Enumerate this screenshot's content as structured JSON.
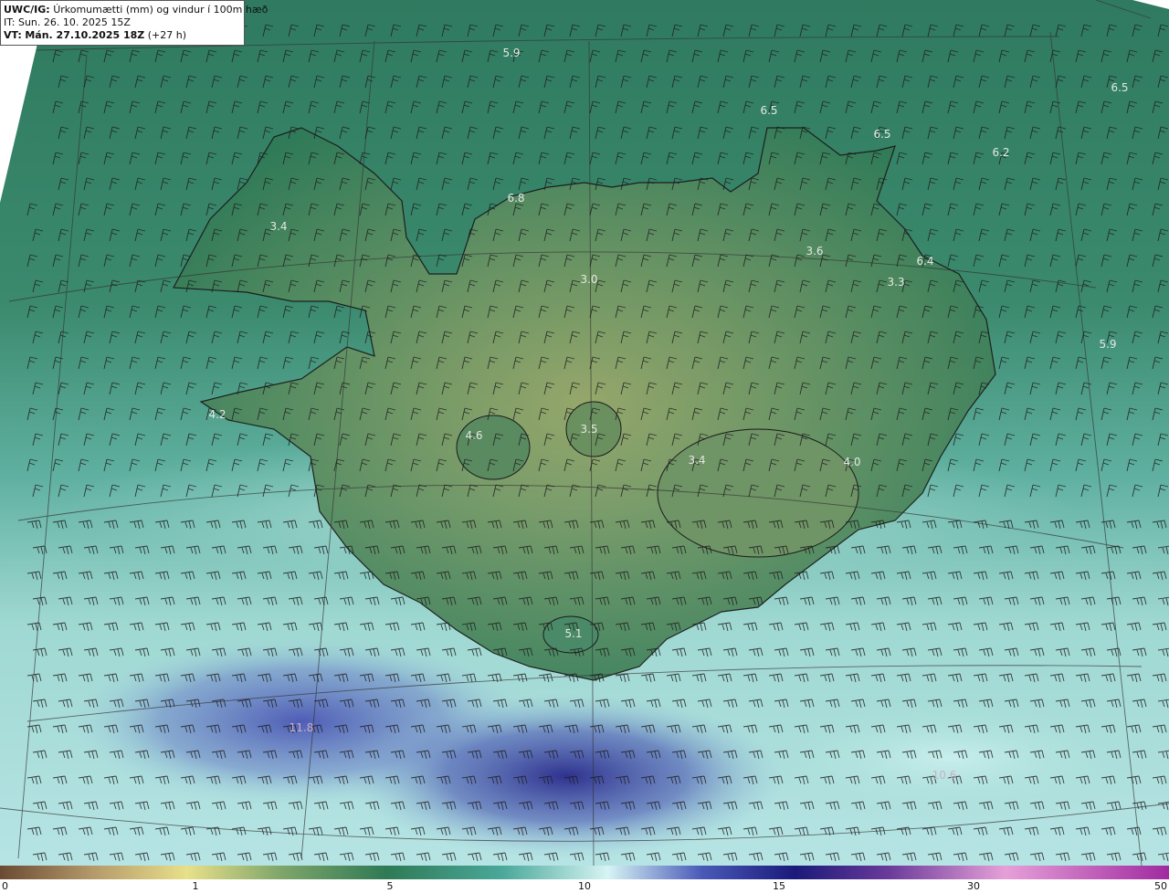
{
  "header": {
    "product_code": "UWC/IG:",
    "product_desc": "Úrkomumætti (mm) og vindur í 100m hæð",
    "init_prefix": "IT:",
    "init_time": "Sun. 26. 10. 2025 15Z",
    "valid_prefix": "VT:",
    "valid_time": "Mán. 27.10.2025 18Z",
    "lead_time": "(+27 h)"
  },
  "map_values": [
    {
      "text": "5.9",
      "level": 5.9
    },
    {
      "text": "6.5",
      "level": 6.5
    },
    {
      "text": "6.5",
      "level": 6.5
    },
    {
      "text": "6.5",
      "level": 6.5
    },
    {
      "text": "6.2",
      "level": 6.2
    },
    {
      "text": "6.8",
      "level": 6.8
    },
    {
      "text": "3.4",
      "level": 3.4
    },
    {
      "text": "3.6",
      "level": 3.6
    },
    {
      "text": "3.0",
      "level": 3.0
    },
    {
      "text": "3.3",
      "level": 3.3
    },
    {
      "text": "6.4",
      "level": 6.4
    },
    {
      "text": "5.9",
      "level": 5.9
    },
    {
      "text": "4.2",
      "level": 4.2
    },
    {
      "text": "4.6",
      "level": 4.6
    },
    {
      "text": "3.5",
      "level": 3.5
    },
    {
      "text": "3.4",
      "level": 3.4
    },
    {
      "text": "4.0",
      "level": 4.0
    },
    {
      "text": "5.1",
      "level": 5.1
    },
    {
      "text": "11.8",
      "level": 11.8
    },
    {
      "text": "10.6",
      "level": 10.6
    }
  ],
  "colorbar": {
    "ticks": [
      "0",
      "1",
      "5",
      "10",
      "15",
      "30",
      "50"
    ],
    "colors": {
      "brown": "#6b4a33",
      "tan": "#b59a6a",
      "yellow": "#e8e08a",
      "green_light": "#7fa66a",
      "green": "#2f7a55",
      "teal": "#4aa89a",
      "cyan_light": "#d6f4f4",
      "blue": "#4a5ab8",
      "navy": "#1a1a7a",
      "purple": "#6a3a9a",
      "pink": "#e6a0d8",
      "magenta": "#a02aa0"
    }
  }
}
